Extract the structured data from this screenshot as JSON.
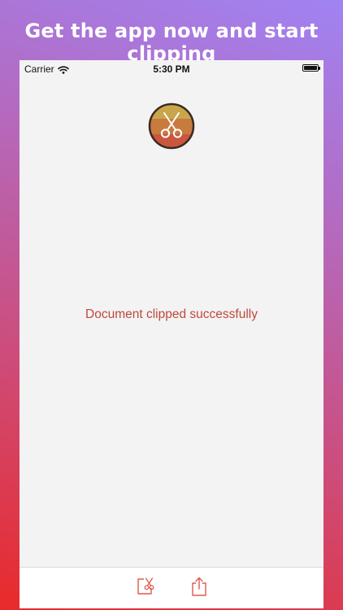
{
  "headline": "Get the app now and start clipping",
  "status_bar": {
    "carrier": "Carrier",
    "time": "5:30 PM",
    "wifi_icon": "wifi-icon",
    "battery_icon": "battery-full-icon"
  },
  "logo": {
    "icon": "scissors-icon",
    "colors": [
      "#c9a64b",
      "#c87b3f",
      "#c9563d"
    ]
  },
  "message": "Document clipped successfully",
  "toolbar": {
    "items": [
      {
        "name": "clip-document",
        "icon": "clip-scissors-icon"
      },
      {
        "name": "share",
        "icon": "share-icon"
      }
    ],
    "accent_color": "#e0584c"
  }
}
